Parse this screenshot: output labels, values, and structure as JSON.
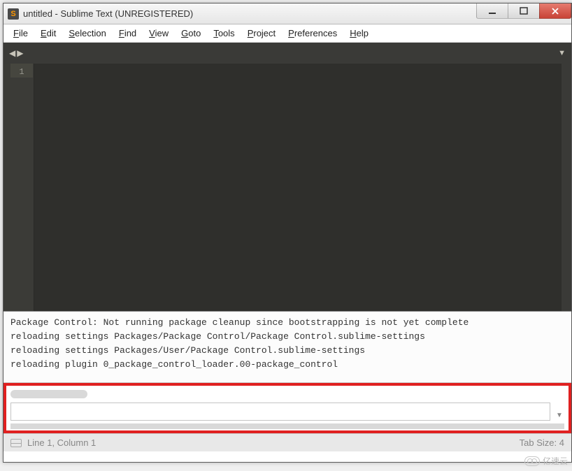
{
  "window": {
    "title": "untitled - Sublime Text (UNREGISTERED)",
    "app_icon_letter": "S"
  },
  "menubar": {
    "items": [
      {
        "label": "File",
        "underline": 0
      },
      {
        "label": "Edit",
        "underline": 0
      },
      {
        "label": "Selection",
        "underline": 0
      },
      {
        "label": "Find",
        "underline": 0
      },
      {
        "label": "View",
        "underline": 0
      },
      {
        "label": "Goto",
        "underline": 0
      },
      {
        "label": "Tools",
        "underline": 0
      },
      {
        "label": "Project",
        "underline": 0
      },
      {
        "label": "Preferences",
        "underline": 0
      },
      {
        "label": "Help",
        "underline": 0
      }
    ]
  },
  "tabs": {
    "prev_glyph": "◀",
    "next_glyph": "▶",
    "dropdown_glyph": "▼"
  },
  "editor": {
    "first_line_number": "1"
  },
  "console": {
    "lines": [
      "Package Control: Not running package cleanup since bootstrapping is not yet complete",
      "reloading settings Packages/Package Control/Package Control.sublime-settings",
      "reloading settings Packages/User/Package Control.sublime-settings",
      "reloading plugin 0_package_control_loader.00-package_control"
    ]
  },
  "input_panel": {
    "dropdown_glyph": "▼",
    "value": ""
  },
  "statusbar": {
    "position": "Line 1, Column 1",
    "tabsize": "Tab Size: 4"
  },
  "watermark": {
    "text": "亿速云"
  },
  "colors": {
    "editor_bg": "#2f2f2c",
    "gutter_bg": "#3b3b37",
    "tabstrip_bg": "#3a3a37",
    "highlight_border": "#e02020",
    "close_btn": "#c84336"
  }
}
